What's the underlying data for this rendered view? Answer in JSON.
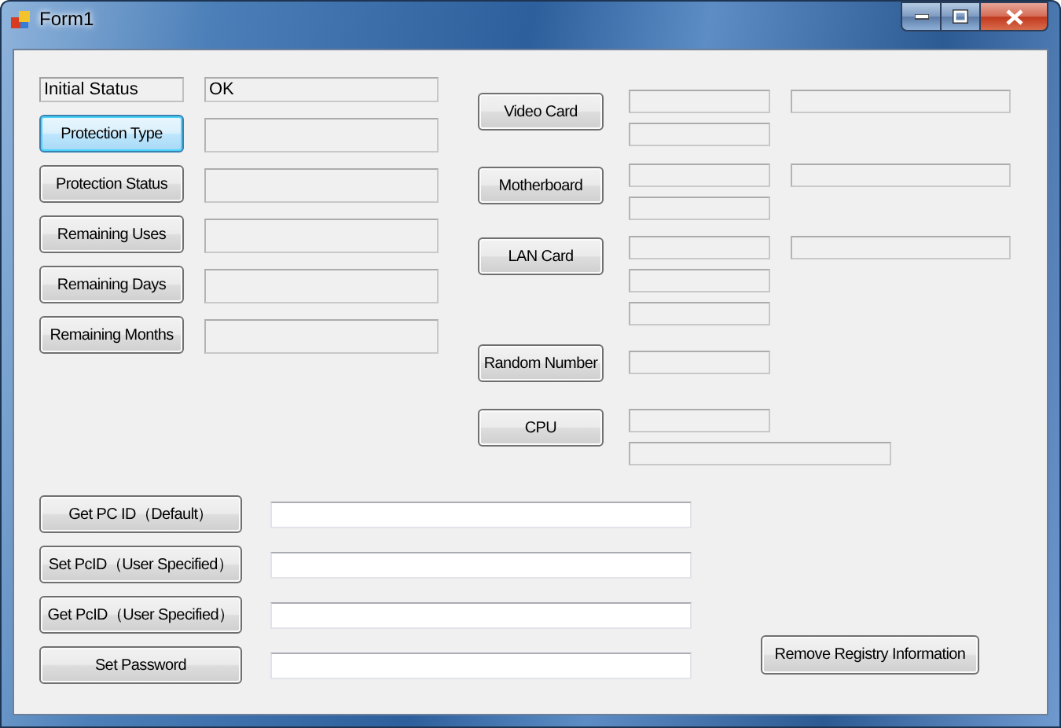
{
  "window": {
    "title": "Form1"
  },
  "status": {
    "label": "Initial Status",
    "value": "OK"
  },
  "info_buttons": [
    {
      "label": "Protection Type",
      "focused": true
    },
    {
      "label": "Protection Status",
      "focused": false
    },
    {
      "label": "Remaining Uses",
      "focused": false
    },
    {
      "label": "Remaining Days",
      "focused": false
    },
    {
      "label": "Remaining Months",
      "focused": false
    }
  ],
  "hardware_buttons": [
    {
      "label": "Video Card"
    },
    {
      "label": "Motherboard"
    },
    {
      "label": "LAN Card"
    },
    {
      "label": "Random Number"
    },
    {
      "label": "CPU"
    }
  ],
  "id_buttons": [
    {
      "label": "Get PC ID（Default）"
    },
    {
      "label": "Set PcID（User Specified）"
    },
    {
      "label": "Get PcID（User Specified）"
    },
    {
      "label": "Set Password"
    }
  ],
  "remove_button": {
    "label": "Remove Registry Information"
  }
}
